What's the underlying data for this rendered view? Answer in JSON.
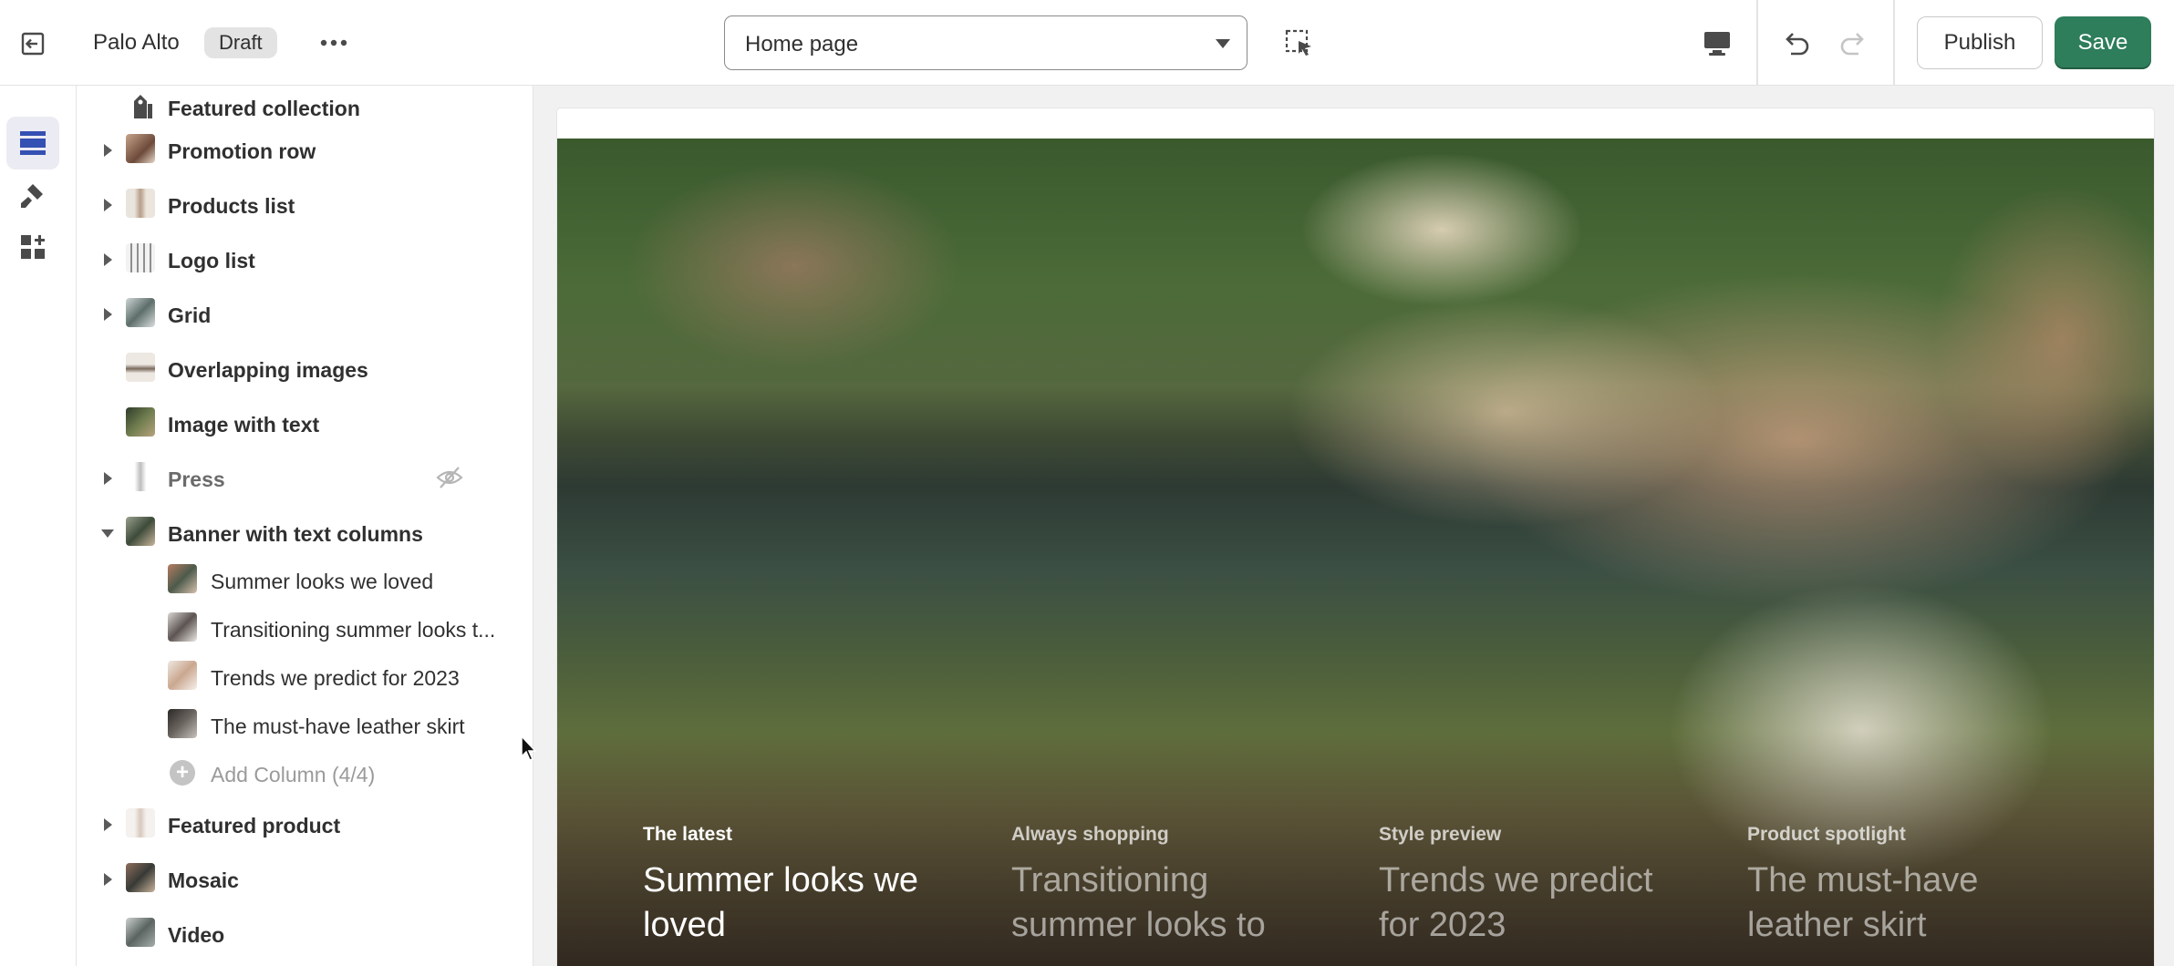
{
  "topbar": {
    "store_name": "Palo Alto",
    "status_badge": "Draft",
    "page_selector": "Home page",
    "publish_label": "Publish",
    "save_label": "Save"
  },
  "icons": {
    "exit": "exit-icon",
    "more": "more-horizontal-icon",
    "inspect": "inspect-select-icon",
    "desktop": "desktop-icon",
    "undo": "undo-icon",
    "redo": "redo-icon",
    "sections": "sections-icon",
    "theme_settings": "paintbrush-icon",
    "apps": "apps-icon",
    "hidden": "eye-hidden-icon",
    "add": "plus-circle-icon"
  },
  "colors": {
    "save_button": "#2e7d5b",
    "active_rail": "#ebebf3",
    "rail_icon_active": "#3550b3"
  },
  "sidebar": {
    "sections": [
      {
        "label": "Featured collection",
        "expandable": false
      },
      {
        "label": "Promotion row",
        "expandable": true
      },
      {
        "label": "Products list",
        "expandable": true
      },
      {
        "label": "Logo list",
        "expandable": true
      },
      {
        "label": "Grid",
        "expandable": true
      },
      {
        "label": "Overlapping images",
        "expandable": false
      },
      {
        "label": "Image with text",
        "expandable": false
      },
      {
        "label": "Press",
        "expandable": true,
        "hidden": true
      },
      {
        "label": "Banner with text columns",
        "expandable": true,
        "expanded": true
      },
      {
        "label": "Featured product",
        "expandable": true
      },
      {
        "label": "Mosaic",
        "expandable": true
      },
      {
        "label": "Video",
        "expandable": false
      }
    ],
    "banner_columns": [
      "Summer looks we loved",
      "Transitioning summer looks t...",
      "Trends we predict for 2023",
      "The must-have leather skirt"
    ],
    "add_column_label": "Add Column (4/4)"
  },
  "preview": {
    "columns": [
      {
        "eyebrow": "The latest",
        "heading_line1": "Summer looks we",
        "heading_line2": "loved"
      },
      {
        "eyebrow": "Always shopping",
        "heading_line1": "Transitioning",
        "heading_line2": "summer looks to"
      },
      {
        "eyebrow": "Style preview",
        "heading_line1": "Trends we predict",
        "heading_line2": "for 2023"
      },
      {
        "eyebrow": "Product spotlight",
        "heading_line1": "The must-have",
        "heading_line2": "leather skirt"
      }
    ]
  }
}
